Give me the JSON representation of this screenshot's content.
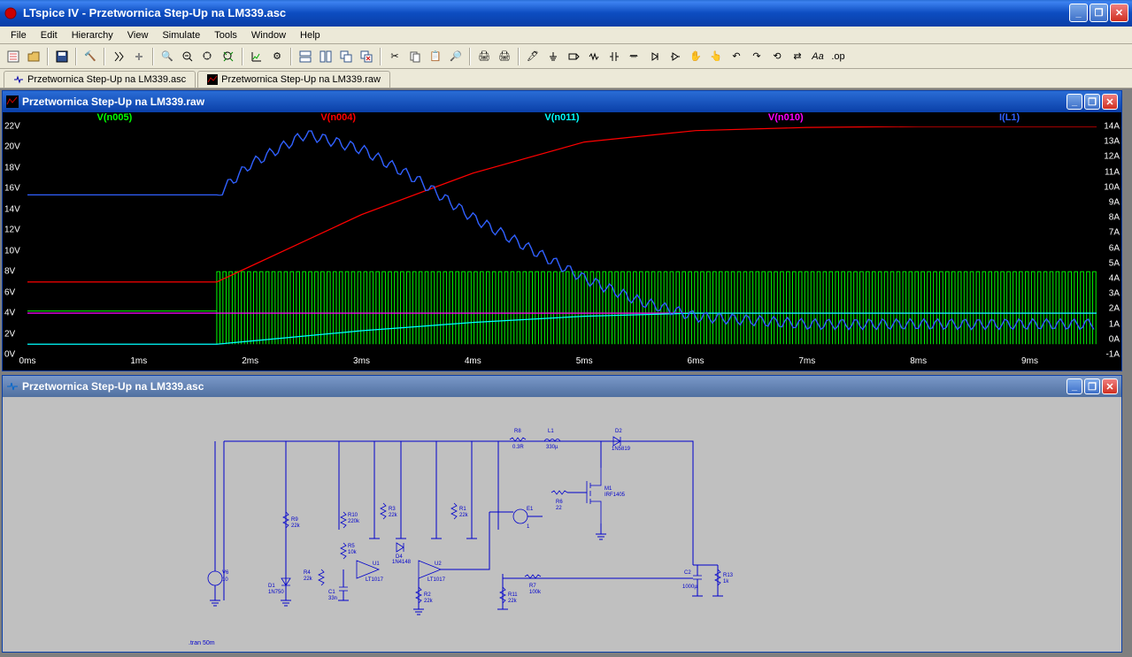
{
  "app": {
    "title": "LTspice IV - Przetwornica Step-Up na LM339.asc"
  },
  "menu": [
    "File",
    "Edit",
    "Hierarchy",
    "View",
    "Simulate",
    "Tools",
    "Window",
    "Help"
  ],
  "doctabs": [
    {
      "label": "Przetwornica Step-Up na LM339.asc",
      "active": false
    },
    {
      "label": "Przetwornica Step-Up na LM339.raw",
      "active": true
    }
  ],
  "waveform_window": {
    "title": "Przetwornica Step-Up na LM339.raw"
  },
  "schematic_window": {
    "title": "Przetwornica Step-Up na LM339.asc"
  },
  "chart_data": {
    "type": "line",
    "title": "",
    "xlabel": "time",
    "ylabel_left": "Voltage",
    "ylabel_right": "Current",
    "xlim": [
      0,
      9.6
    ],
    "ylim_left": [
      0,
      22
    ],
    "ylim_right": [
      -1,
      14
    ],
    "xticks": [
      "0ms",
      "1ms",
      "2ms",
      "3ms",
      "4ms",
      "5ms",
      "6ms",
      "7ms",
      "8ms",
      "9ms"
    ],
    "yticks_left": [
      "0V",
      "2V",
      "4V",
      "6V",
      "8V",
      "10V",
      "12V",
      "14V",
      "16V",
      "18V",
      "20V",
      "22V"
    ],
    "yticks_right": [
      "-1A",
      "0A",
      "1A",
      "2A",
      "3A",
      "4A",
      "5A",
      "6A",
      "7A",
      "8A",
      "9A",
      "10A",
      "11A",
      "12A",
      "13A",
      "14A"
    ],
    "series": [
      {
        "name": "V(n005)",
        "color": "#00ff00",
        "axis": "left",
        "note": "PWM 1-8V pulses starting ~1.7ms"
      },
      {
        "name": "V(n004)",
        "color": "#ff0000",
        "axis": "left",
        "x": [
          0,
          1,
          1.7,
          2,
          2.5,
          3,
          3.5,
          4,
          4.5,
          5,
          6,
          7,
          8,
          9,
          9.6
        ],
        "y": [
          7,
          7,
          7,
          8.5,
          11,
          13.5,
          15.5,
          17.5,
          19,
          20.5,
          21.6,
          21.9,
          22,
          22,
          22
        ]
      },
      {
        "name": "V(n011)",
        "color": "#00ffff",
        "axis": "left",
        "x": [
          0,
          1.7,
          2,
          2.5,
          3,
          3.5,
          4,
          5,
          6,
          9.6
        ],
        "y": [
          1,
          1,
          1.3,
          1.8,
          2.3,
          2.7,
          3.1,
          3.7,
          4,
          4
        ]
      },
      {
        "name": "V(n010)",
        "color": "#ff00ff",
        "axis": "left",
        "x": [
          0,
          9.6
        ],
        "y": [
          4,
          4
        ]
      },
      {
        "name": "I(L1)",
        "color": "#3060ff",
        "axis": "right",
        "x": [
          0,
          1.7,
          2,
          2.5,
          3,
          3.5,
          4,
          4.5,
          5,
          5.5,
          6,
          7,
          9.6
        ],
        "y": [
          9.5,
          9.5,
          11.5,
          13.5,
          12.5,
          10.5,
          8,
          6,
          4,
          2.5,
          1.5,
          1,
          1
        ]
      }
    ]
  },
  "schematic_labels": {
    "sim_cmd": ".tran 50m",
    "R8": "R8",
    "R8v": "0.3R",
    "L1": "L1",
    "L1v": "330µ",
    "D2": "D2",
    "D2v": "1N5819",
    "M1": "M1",
    "M1v": "IRF1405",
    "R6": "R6",
    "R6v": "22",
    "E1": "E1",
    "E1v": "1",
    "R9": "R9",
    "R9v": "22k",
    "R1": "R1",
    "R1v": "22k",
    "R3": "R3",
    "R3v": "22k",
    "R10": "R10",
    "R10v": "220k",
    "R5": "R5",
    "R5v": "10k",
    "D4": "D4",
    "D4v": "1N4148",
    "U1": "U1",
    "U1v": "LT1017",
    "U2": "U2",
    "U2v": "LT1017",
    "R4": "R4",
    "R4v": "22k",
    "C1": "C1",
    "C1v": "33n",
    "D1": "D1",
    "D1v": "1N750",
    "V6": "V6",
    "V6v": "10",
    "R2": "R2",
    "R2v": "22k",
    "R7": "R7",
    "R7v": "100k",
    "R11": "R11",
    "R11v": "22k",
    "C2": "C2",
    "C2v": "1000µ",
    "R13": "R13",
    "R13v": "1k"
  }
}
